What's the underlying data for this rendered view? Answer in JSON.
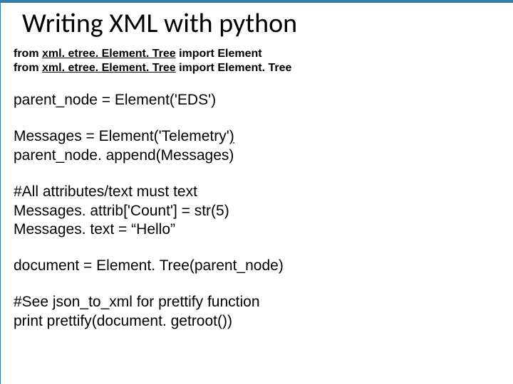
{
  "title": "Writing XML with python",
  "imports": {
    "line1_pre": "from ",
    "line1_mod": "xml. etree. Element. Tree",
    "line1_mid": " import ",
    "line1_post": "Element",
    "line2_pre": "from ",
    "line2_mod": "xml. etree. Element. Tree",
    "line2_mid": " import ",
    "line2_post": "Element. Tree"
  },
  "code": {
    "block1": "parent_node  = Element('EDS')",
    "block2_line1_pre": "Messages = Element('Telemetry'",
    "block2_line1_u": ")",
    "block2_line2": "parent_node. append(Messages)",
    "block3_line1": "#All attributes/text must text",
    "block3_line2": "Messages. attrib['Count'] = str(5)",
    "block3_line3": "Messages. text = “Hello”",
    "block4": "document     = Element. Tree(parent_node)",
    "block5_line1": "#See json_to_xml for prettify function",
    "block5_line2": "print prettify(document. getroot())"
  }
}
